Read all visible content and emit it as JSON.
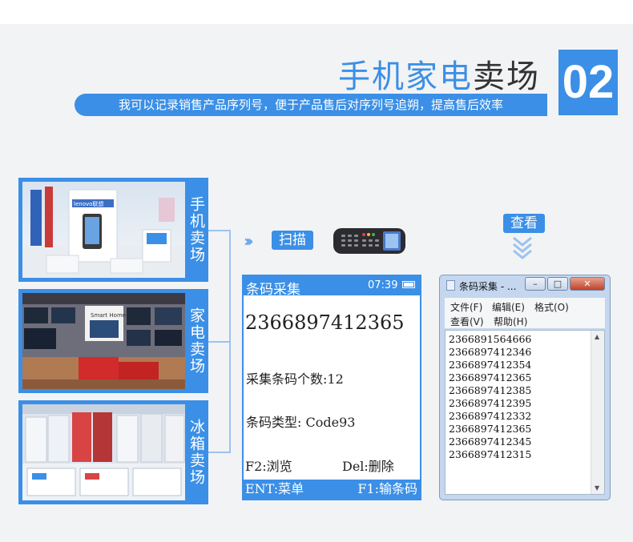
{
  "header": {
    "title_part1": "手机家电",
    "title_part2": "卖场",
    "number": "02",
    "subtitle": "我可以记录销售产品序列号，便于产品售后对序列号追朔，提高售后效率"
  },
  "photos": [
    {
      "caption": "手机卖场"
    },
    {
      "caption": "家电卖场"
    },
    {
      "caption": "冰箱卖场"
    }
  ],
  "photo_signs": {
    "lenovo": "lenovo联想",
    "smart_home": "Smart Home"
  },
  "flow": {
    "scan_label": "扫描",
    "view_label": "查看"
  },
  "device": {
    "header_title": "条码采集",
    "time": "07:39",
    "barcode": "2366897412365",
    "count_label": "采集条码个数:12",
    "type_label": "条码类型: Code93",
    "f2": "F2:浏览",
    "del": "Del:删除",
    "ent": "ENT:菜单",
    "f1": "F1:输条码"
  },
  "notepad": {
    "title": "条码采集 - ...",
    "menus": [
      "文件(F)",
      "编辑(E)",
      "格式(O)",
      "查看(V)",
      "帮助(H)"
    ],
    "lines": [
      "2366891564666",
      "2366897412346",
      "2366897412354",
      "2366897412365",
      "2366897412385",
      "2366897412395",
      "2366897412332",
      "2366897412365",
      "2366897412345",
      "2366897412315"
    ]
  },
  "colors": {
    "accent": "#3b8fe6",
    "accent_light": "#6aaaf0",
    "text_dark": "#333333"
  }
}
